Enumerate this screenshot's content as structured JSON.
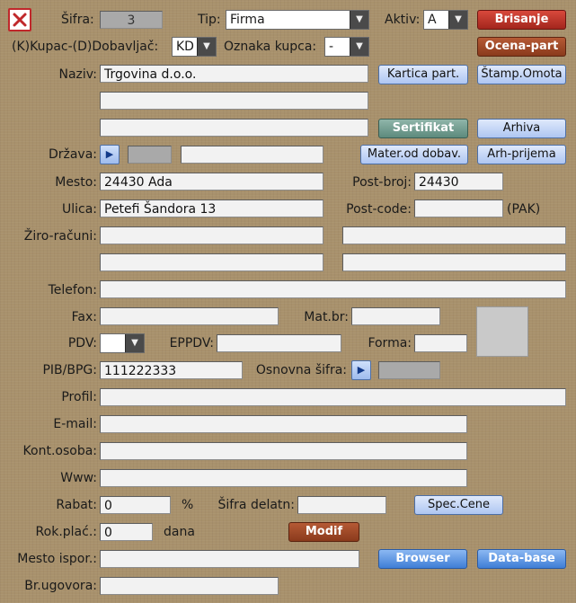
{
  "header": {
    "sifra_label": "Šifra:",
    "sifra_value": "3",
    "tip_label": "Tip:",
    "tip_value": "Firma",
    "aktiv_label": "Aktiv:",
    "aktiv_value": "A",
    "brisanje_label": "Brisanje",
    "kupac_dob_label": "(K)Kupac-(D)Dobavljač:",
    "kupac_dob_value": "KD",
    "oznaka_label": "Oznaka kupca:",
    "oznaka_value": "-",
    "ocena_label": "Ocena-part"
  },
  "naziv": {
    "label": "Naziv:",
    "line1": "Trgovina d.o.o.",
    "line2": "",
    "line3": ""
  },
  "buttons": {
    "kartica": "Kartica part.",
    "stamp": "Štamp.Omota",
    "sertifikat": "Sertifikat",
    "arhiva": "Arhiva",
    "mater": "Mater.od dobav.",
    "arh_prijema": "Arh-prijema",
    "spec_cene": "Spec.Cene",
    "modif": "Modif",
    "browser": "Browser",
    "database": "Data-base"
  },
  "address": {
    "drzava_label": "Država:",
    "drzava_code": "",
    "drzava_name": "",
    "mesto_label": "Mesto:",
    "mesto_value": "24430 Ada",
    "postbroj_label": "Post-broj:",
    "postbroj_value": "24430",
    "ulica_label": "Ulica:",
    "ulica_value": "Petefi Šandora 13",
    "postcode_label": "Post-code:",
    "postcode_value": "",
    "pak_label": "(PAK)",
    "ziro_label": "Žiro-računi:"
  },
  "contact": {
    "telefon_label": "Telefon:",
    "fax_label": "Fax:",
    "matbr_label": "Mat.br:",
    "pdv_label": "PDV:",
    "pdv_value": "",
    "eppdv_label": "EPPDV:",
    "forma_label": "Forma:",
    "pib_label": "PIB/BPG:",
    "pib_value": "111222333",
    "osnovna_label": "Osnovna šifra:",
    "profil_label": "Profil:",
    "email_label": "E-mail:",
    "kont_label": "Kont.osoba:",
    "www_label": "Www:"
  },
  "terms": {
    "rabat_label": "Rabat:",
    "rabat_value": "0",
    "percent": "%",
    "sifra_delatn_label": "Šifra delatn:",
    "rok_label": "Rok.plać.:",
    "rok_value": "0",
    "dana_label": "dana",
    "mesto_ispor_label": "Mesto ispor.:",
    "br_ugovora_label": "Br.ugovora:"
  }
}
